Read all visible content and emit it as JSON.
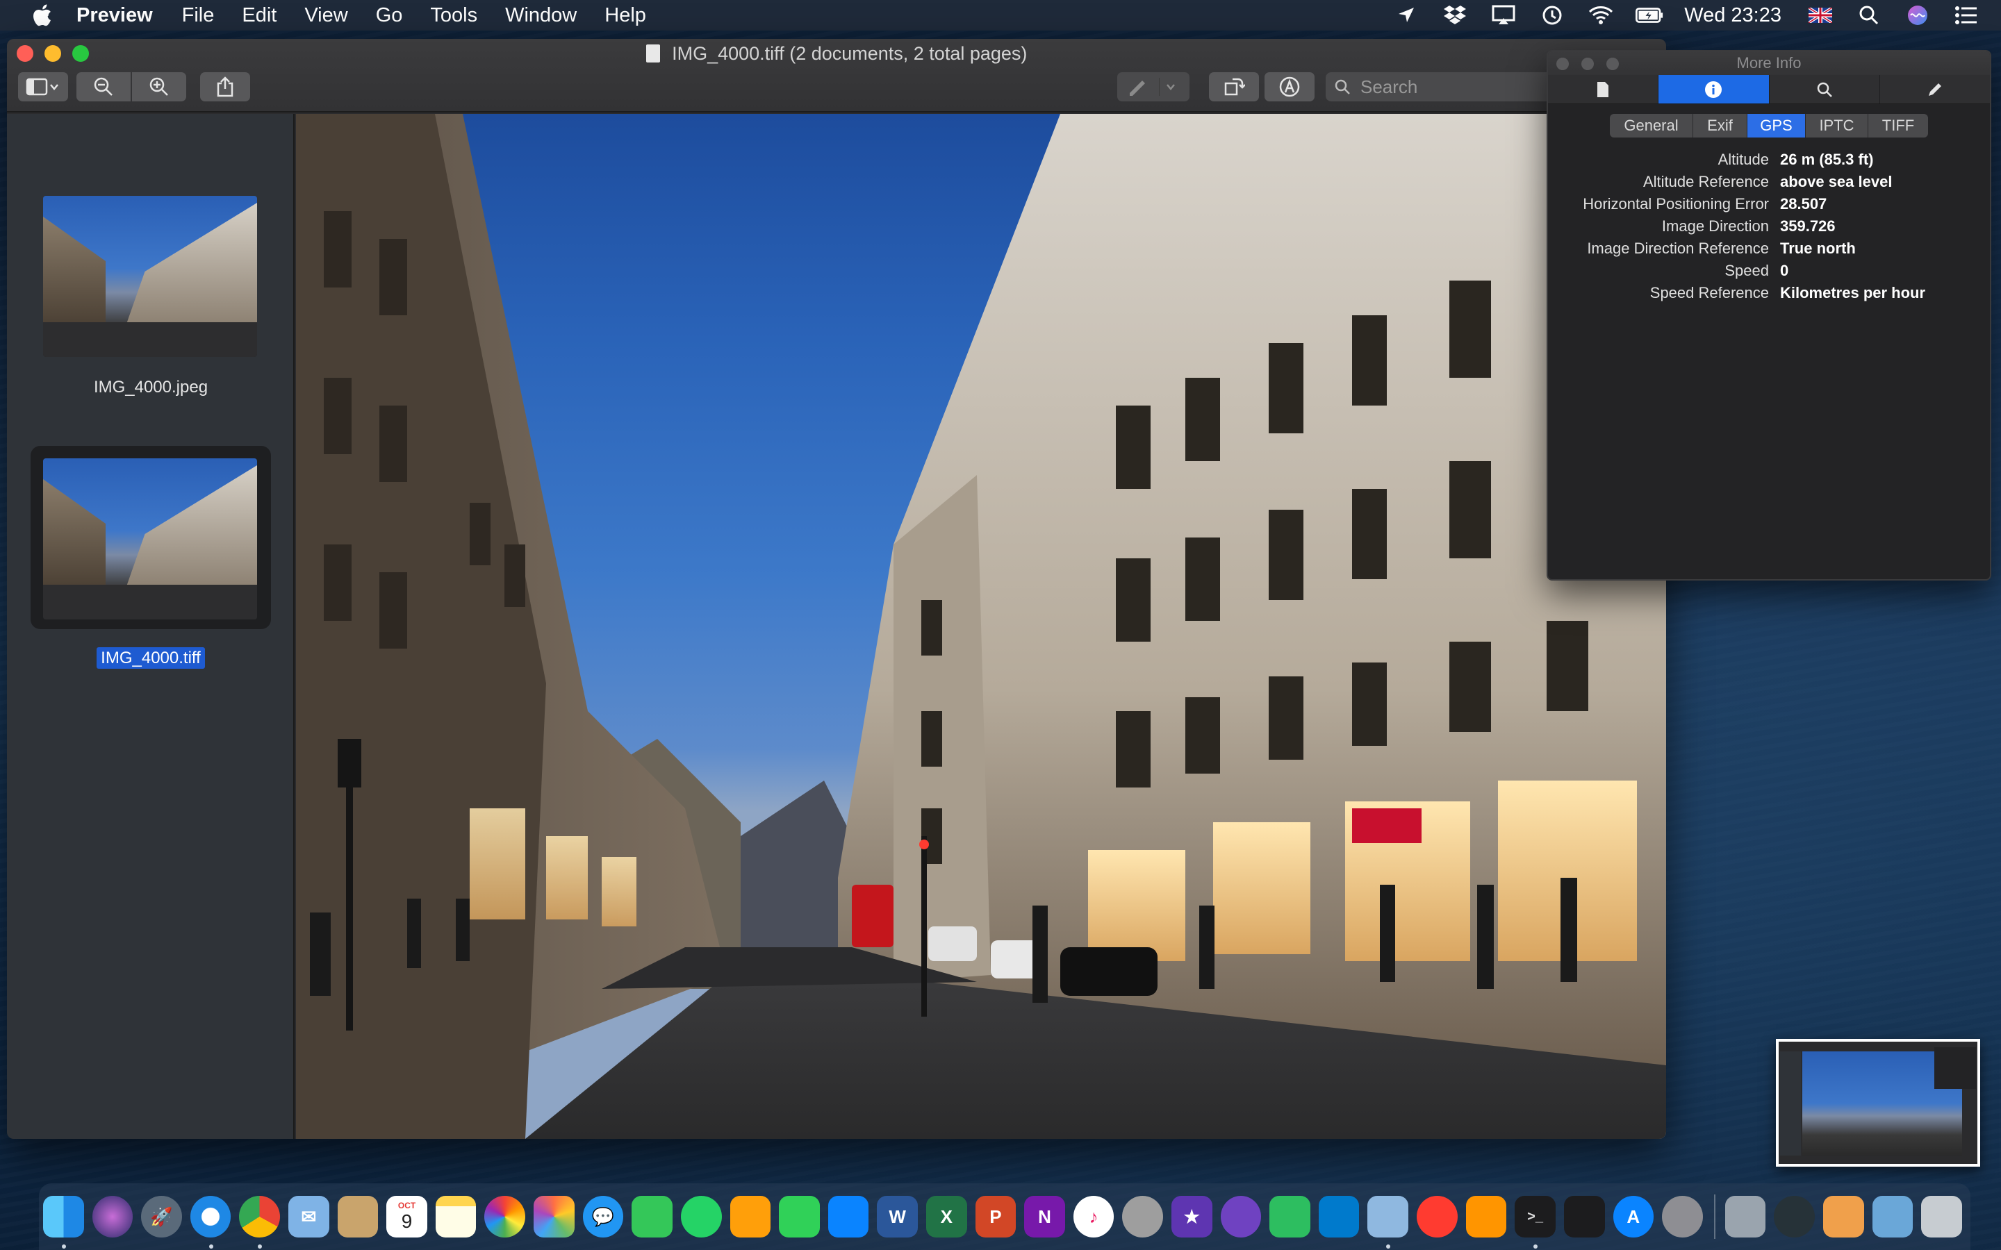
{
  "menubar": {
    "app_name": "Preview",
    "menus": [
      "File",
      "Edit",
      "View",
      "Go",
      "Tools",
      "Window",
      "Help"
    ],
    "clock": "Wed 23:23",
    "status_icons": [
      "location-icon",
      "dropbox-icon",
      "airplay-icon",
      "time-machine-icon",
      "wifi-icon",
      "battery-icon",
      "flag-uk-icon",
      "spotlight-icon",
      "siri-icon",
      "notification-center-icon"
    ]
  },
  "window": {
    "title": "IMG_4000.tiff (2 documents, 2 total pages)",
    "search_placeholder": "Search"
  },
  "sidebar": {
    "items": [
      {
        "label": "IMG_4000.jpeg",
        "selected": false
      },
      {
        "label": "IMG_4000.tiff",
        "selected": true
      }
    ]
  },
  "info_panel": {
    "title": "More Info",
    "tabs": [
      "General",
      "Exif",
      "GPS",
      "IPTC",
      "TIFF"
    ],
    "active_tab": "GPS",
    "rows": [
      {
        "key": "Altitude",
        "value": "26 m (85.3 ft)"
      },
      {
        "key": "Altitude Reference",
        "value": "above sea level"
      },
      {
        "key": "Horizontal Positioning Error",
        "value": "28.507"
      },
      {
        "key": "Image Direction",
        "value": "359.726"
      },
      {
        "key": "Image Direction Reference",
        "value": "True north"
      },
      {
        "key": "Speed",
        "value": "0"
      },
      {
        "key": "Speed Reference",
        "value": "Kilometres per hour"
      }
    ]
  },
  "dock": {
    "apps": [
      "finder",
      "siri",
      "launchpad",
      "safari",
      "chrome",
      "mail-bird",
      "contacts",
      "calendar",
      "notes",
      "photos",
      "pixelmator",
      "messages",
      "facetime",
      "whatsapp",
      "pages",
      "numbers",
      "keynote",
      "word",
      "excel",
      "powerpoint",
      "onenote",
      "itunes",
      "disk-utility",
      "imovie",
      "github-desktop",
      "evernote",
      "vscode",
      "preview",
      "news",
      "home",
      "terminal",
      "activity-monitor",
      "app-store",
      "system-preferences",
      "automator",
      "sonar",
      "downloads",
      "screenshots",
      "trash"
    ],
    "calendar_month": "OCT",
    "calendar_day": "9"
  },
  "colors": {
    "accent": "#1d6ae5",
    "selection": "#1e5bd1",
    "close": "#ff5f57",
    "minimize": "#febc2e",
    "maximize": "#28c840"
  }
}
